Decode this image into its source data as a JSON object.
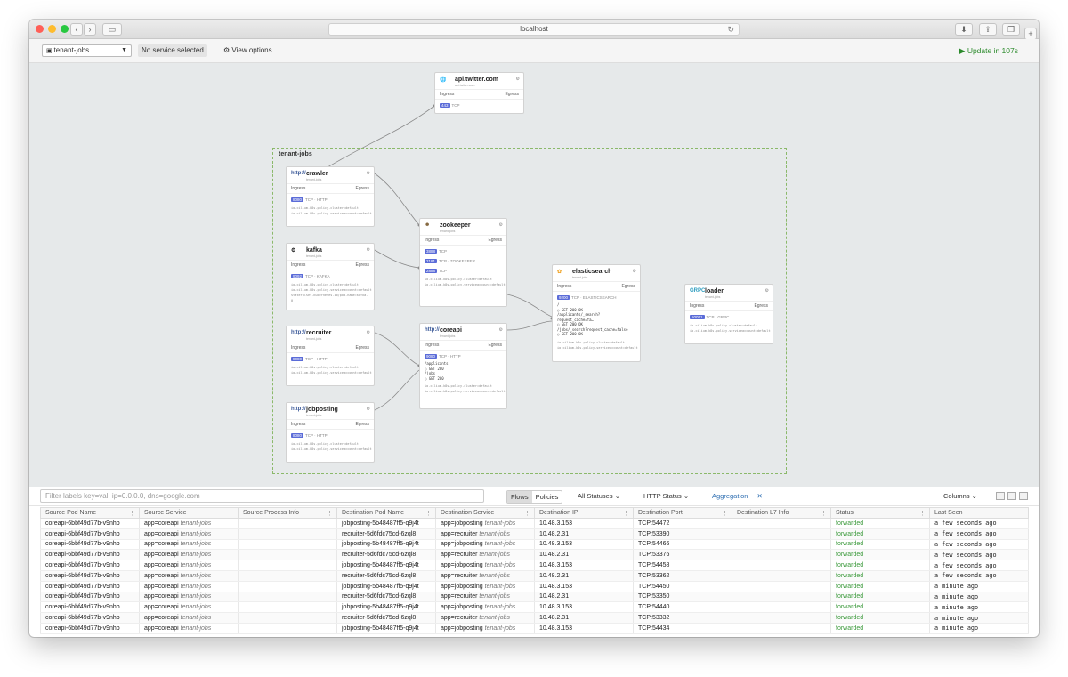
{
  "browser": {
    "url": "localhost",
    "colors": {
      "close": "#ff5f57",
      "minimize": "#febc2e",
      "maximize": "#28c840"
    }
  },
  "toolbar": {
    "namespace": "tenant-jobs",
    "service_selection": "No service selected",
    "view_options": "View options",
    "update_label": "Update in 107s"
  },
  "map": {
    "namespace_label": "tenant-jobs",
    "cards": {
      "twitter": {
        "name": "api.twitter.com",
        "sub": "api.twitter.com",
        "ingress": "Ingress",
        "egress": "Egress",
        "port": "443",
        "proto": "TCP"
      },
      "crawler": {
        "logo": "http://",
        "name": "crawler",
        "sub": "tenant-jobs",
        "ingress": "Ingress",
        "egress": "Egress",
        "port": "8080",
        "proto": "TCP · HTTP",
        "labels": [
          "io.cilium.k8s.policy.cluster=default",
          "io.cilium.k8s.policy.serviceaccount=default"
        ]
      },
      "kafka": {
        "name": "kafka",
        "sub": "tenant-jobs",
        "ingress": "Ingress",
        "egress": "Egress",
        "port": "9092",
        "proto": "TCP · KAFKA",
        "labels": [
          "io.cilium.k8s.policy.cluster=default",
          "io.cilium.k8s.policy.serviceaccount=default",
          "statefulset.kubernetes.io/pod-name=kafka-0"
        ]
      },
      "recruiter": {
        "logo": "http://",
        "name": "recruiter",
        "sub": "tenant-jobs",
        "ingress": "Ingress",
        "egress": "Egress",
        "port": "8080",
        "proto": "TCP · HTTP",
        "labels": [
          "io.cilium.k8s.policy.cluster=default",
          "io.cilium.k8s.policy.serviceaccount=default"
        ]
      },
      "jobposting": {
        "logo": "http://",
        "name": "jobposting",
        "sub": "tenant-jobs",
        "ingress": "Ingress",
        "egress": "Egress",
        "port": "8080",
        "proto": "TCP · HTTP",
        "labels": [
          "io.cilium.k8s.policy.cluster=default",
          "io.cilium.k8s.policy.serviceaccount=default"
        ]
      },
      "zookeeper": {
        "name": "zookeeper",
        "sub": "tenant-jobs",
        "ingress": "Ingress",
        "egress": "Egress",
        "ports": [
          {
            "port": "3888",
            "proto": "TCP"
          },
          {
            "port": "2181",
            "proto": "TCP · ZOOKEEPER"
          },
          {
            "port": "2888",
            "proto": "TCP"
          }
        ],
        "labels": [
          "io.cilium.k8s.policy.cluster=default",
          "io.cilium.k8s.policy.serviceaccount=default"
        ]
      },
      "coreapi": {
        "logo": "http://",
        "name": "coreapi",
        "sub": "tenant-jobs",
        "ingress": "Ingress",
        "egress": "Egress",
        "port": "9080",
        "proto": "TCP · HTTP",
        "l7": [
          "/applicants",
          "○ GET 200",
          "/jobs",
          "○ GET 200"
        ],
        "labels": [
          "io.cilium.k8s.policy.cluster=default",
          "io.cilium.k8s.policy.serviceaccount=default"
        ]
      },
      "elasticsearch": {
        "name": "elasticsearch",
        "sub": "tenant-jobs",
        "ingress": "Ingress",
        "egress": "Egress",
        "port": "9200",
        "proto": "TCP · ELASTICSEARCH",
        "l7": [
          "/",
          "○ GET 200 OK",
          "/applicants/_search?request_cache=fa…",
          "○ GET 200 OK",
          "/jobs/_search?request_cache=false",
          "○ GET 200 OK"
        ],
        "labels": [
          "io.cilium.k8s.policy.cluster=default",
          "io.cilium.k8s.policy.serviceaccount=default"
        ]
      },
      "loader": {
        "logo": "GRPC",
        "name": "loader",
        "sub": "tenant-jobs",
        "ingress": "Ingress",
        "egress": "Egress",
        "port": "50051",
        "proto": "TCP · GRPC",
        "labels": [
          "io.cilium.k8s.policy.cluster=default",
          "io.cilium.k8s.policy.serviceaccount=default"
        ]
      }
    }
  },
  "filterbar": {
    "placeholder": "Filter labels key=val, ip=0.0.0.0, dns=google.com",
    "flows": "Flows",
    "policies": "Policies",
    "statuses": "All Statuses",
    "http_status": "HTTP Status",
    "aggregation": "Aggregation",
    "columns": "Columns"
  },
  "table": {
    "headers": [
      "Source Pod Name",
      "Source Service",
      "Source Process Info",
      "Destination Pod Name",
      "Destination Service",
      "Destination IP",
      "Destination Port",
      "Destination L7 Info",
      "Status",
      "Last Seen"
    ],
    "rows": [
      {
        "src_pod": "coreapi-6bbf49d77b-v9nhb",
        "src_svc": "app=coreapi",
        "src_ns": "tenant-jobs",
        "dst_pod": "jobposting-5b48487ff5-q9j4t",
        "dst_svc": "app=jobposting",
        "dst_ns": "tenant-jobs",
        "dst_ip": "10.48.3.153",
        "dst_port": "TCP:54472",
        "status": "forwarded",
        "seen": "a few seconds ago"
      },
      {
        "src_pod": "coreapi-6bbf49d77b-v9nhb",
        "src_svc": "app=coreapi",
        "src_ns": "tenant-jobs",
        "dst_pod": "recruiter-5d6fdc75cd-6zql8",
        "dst_svc": "app=recruiter",
        "dst_ns": "tenant-jobs",
        "dst_ip": "10.48.2.31",
        "dst_port": "TCP:53390",
        "status": "forwarded",
        "seen": "a few seconds ago"
      },
      {
        "src_pod": "coreapi-6bbf49d77b-v9nhb",
        "src_svc": "app=coreapi",
        "src_ns": "tenant-jobs",
        "dst_pod": "jobposting-5b48487ff5-q9j4t",
        "dst_svc": "app=jobposting",
        "dst_ns": "tenant-jobs",
        "dst_ip": "10.48.3.153",
        "dst_port": "TCP:54466",
        "status": "forwarded",
        "seen": "a few seconds ago"
      },
      {
        "src_pod": "coreapi-6bbf49d77b-v9nhb",
        "src_svc": "app=coreapi",
        "src_ns": "tenant-jobs",
        "dst_pod": "recruiter-5d6fdc75cd-6zql8",
        "dst_svc": "app=recruiter",
        "dst_ns": "tenant-jobs",
        "dst_ip": "10.48.2.31",
        "dst_port": "TCP:53376",
        "status": "forwarded",
        "seen": "a few seconds ago"
      },
      {
        "src_pod": "coreapi-6bbf49d77b-v9nhb",
        "src_svc": "app=coreapi",
        "src_ns": "tenant-jobs",
        "dst_pod": "jobposting-5b48487ff5-q9j4t",
        "dst_svc": "app=jobposting",
        "dst_ns": "tenant-jobs",
        "dst_ip": "10.48.3.153",
        "dst_port": "TCP:54458",
        "status": "forwarded",
        "seen": "a few seconds ago"
      },
      {
        "src_pod": "coreapi-6bbf49d77b-v9nhb",
        "src_svc": "app=coreapi",
        "src_ns": "tenant-jobs",
        "dst_pod": "recruiter-5d6fdc75cd-6zql8",
        "dst_svc": "app=recruiter",
        "dst_ns": "tenant-jobs",
        "dst_ip": "10.48.2.31",
        "dst_port": "TCP:53362",
        "status": "forwarded",
        "seen": "a few seconds ago"
      },
      {
        "src_pod": "coreapi-6bbf49d77b-v9nhb",
        "src_svc": "app=coreapi",
        "src_ns": "tenant-jobs",
        "dst_pod": "jobposting-5b48487ff5-q9j4t",
        "dst_svc": "app=jobposting",
        "dst_ns": "tenant-jobs",
        "dst_ip": "10.48.3.153",
        "dst_port": "TCP:54450",
        "status": "forwarded",
        "seen": "a minute ago"
      },
      {
        "src_pod": "coreapi-6bbf49d77b-v9nhb",
        "src_svc": "app=coreapi",
        "src_ns": "tenant-jobs",
        "dst_pod": "recruiter-5d6fdc75cd-6zql8",
        "dst_svc": "app=recruiter",
        "dst_ns": "tenant-jobs",
        "dst_ip": "10.48.2.31",
        "dst_port": "TCP:53350",
        "status": "forwarded",
        "seen": "a minute ago"
      },
      {
        "src_pod": "coreapi-6bbf49d77b-v9nhb",
        "src_svc": "app=coreapi",
        "src_ns": "tenant-jobs",
        "dst_pod": "jobposting-5b48487ff5-q9j4t",
        "dst_svc": "app=jobposting",
        "dst_ns": "tenant-jobs",
        "dst_ip": "10.48.3.153",
        "dst_port": "TCP:54440",
        "status": "forwarded",
        "seen": "a minute ago"
      },
      {
        "src_pod": "coreapi-6bbf49d77b-v9nhb",
        "src_svc": "app=coreapi",
        "src_ns": "tenant-jobs",
        "dst_pod": "recruiter-5d6fdc75cd-6zql8",
        "dst_svc": "app=recruiter",
        "dst_ns": "tenant-jobs",
        "dst_ip": "10.48.2.31",
        "dst_port": "TCP:53332",
        "status": "forwarded",
        "seen": "a minute ago"
      },
      {
        "src_pod": "coreapi-6bbf49d77b-v9nhb",
        "src_svc": "app=coreapi",
        "src_ns": "tenant-jobs",
        "dst_pod": "jobposting-5b48487ff5-q9j4t",
        "dst_svc": "app=jobposting",
        "dst_ns": "tenant-jobs",
        "dst_ip": "10.48.3.153",
        "dst_port": "TCP:54434",
        "status": "forwarded",
        "seen": "a minute ago"
      }
    ]
  }
}
